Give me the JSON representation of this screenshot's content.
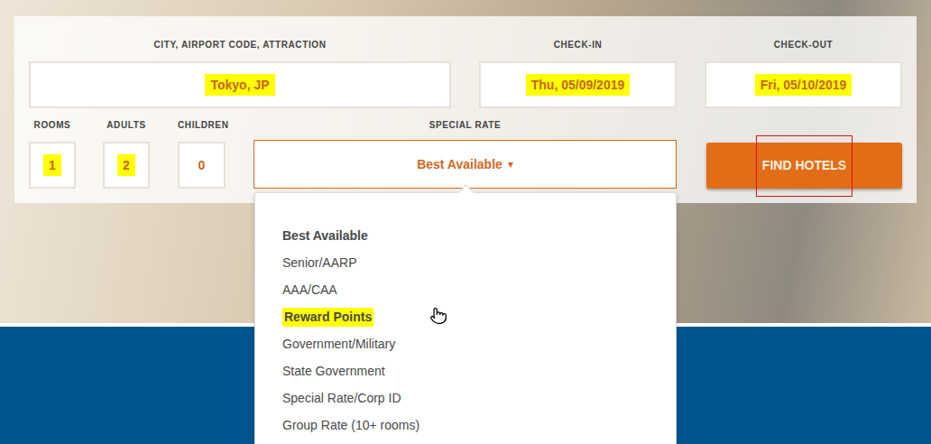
{
  "search": {
    "destination": {
      "label": "CITY, AIRPORT CODE, ATTRACTION",
      "value": "Tokyo, JP",
      "highlighted": true
    },
    "check_in": {
      "label": "CHECK-IN",
      "value": "Thu, 05/09/2019",
      "highlighted": true
    },
    "check_out": {
      "label": "CHECK-OUT",
      "value": "Fri, 05/10/2019",
      "highlighted": true
    },
    "rooms": {
      "label": "ROOMS",
      "value": "1",
      "highlighted": true
    },
    "adults": {
      "label": "ADULTS",
      "value": "2",
      "highlighted": true
    },
    "children": {
      "label": "CHILDREN",
      "value": "0",
      "highlighted": false
    },
    "special_rate": {
      "label": "SPECIAL RATE",
      "value": "Best Available",
      "caret": "▾",
      "expanded": true,
      "options": [
        {
          "label": "Best Available",
          "selected": true,
          "highlighted": false,
          "hovered": false
        },
        {
          "label": "Senior/AARP",
          "selected": false,
          "highlighted": false,
          "hovered": false
        },
        {
          "label": "AAA/CAA",
          "selected": false,
          "highlighted": false,
          "hovered": false
        },
        {
          "label": "Reward Points",
          "selected": false,
          "highlighted": true,
          "hovered": true
        },
        {
          "label": "Government/Military",
          "selected": false,
          "highlighted": false,
          "hovered": false
        },
        {
          "label": "State Government",
          "selected": false,
          "highlighted": false,
          "hovered": false
        },
        {
          "label": "Special Rate/Corp ID",
          "selected": false,
          "highlighted": false,
          "hovered": false
        },
        {
          "label": "Group Rate (10+ rooms)",
          "selected": false,
          "highlighted": false,
          "hovered": false
        }
      ]
    },
    "submit": {
      "label": "FIND HOTELS",
      "annotated": true
    }
  }
}
